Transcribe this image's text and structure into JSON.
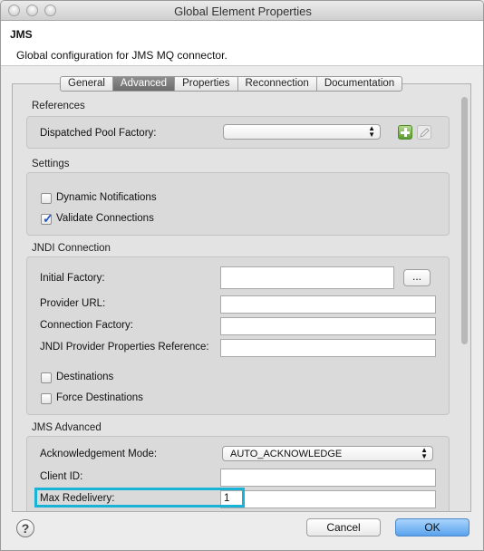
{
  "window": {
    "title": "Global Element Properties"
  },
  "header": {
    "title": "JMS",
    "description": "Global configuration for JMS MQ connector."
  },
  "tabs": [
    {
      "label": "General",
      "active": false
    },
    {
      "label": "Advanced",
      "active": true
    },
    {
      "label": "Properties",
      "active": false
    },
    {
      "label": "Reconnection",
      "active": false
    },
    {
      "label": "Documentation",
      "active": false
    }
  ],
  "references": {
    "section_label": "References",
    "dispatched_pool_factory_label": "Dispatched Pool Factory:",
    "dispatched_pool_factory_value": ""
  },
  "settings": {
    "section_label": "Settings",
    "dynamic_notifications_label": "Dynamic Notifications",
    "dynamic_notifications_checked": false,
    "validate_connections_label": "Validate Connections",
    "validate_connections_checked": true
  },
  "jndi": {
    "section_label": "JNDI Connection",
    "initial_factory_label": "Initial Factory:",
    "initial_factory_value": "",
    "browse_label": "...",
    "provider_url_label": "Provider URL:",
    "provider_url_value": "",
    "connection_factory_label": "Connection Factory:",
    "connection_factory_value": "",
    "provider_props_label": "JNDI Provider Properties Reference:",
    "provider_props_value": "",
    "destinations_label": "Destinations",
    "destinations_checked": false,
    "force_destinations_label": "Force Destinations",
    "force_destinations_checked": false
  },
  "jms_advanced": {
    "section_label": "JMS Advanced",
    "ack_mode_label": "Acknowledgement Mode:",
    "ack_mode_value": "AUTO_ACKNOWLEDGE",
    "client_id_label": "Client ID:",
    "client_id_value": "",
    "max_redelivery_label": "Max Redelivery:",
    "max_redelivery_value": "1"
  },
  "footer": {
    "help_label": "?",
    "cancel_label": "Cancel",
    "ok_label": "OK"
  },
  "colors": {
    "highlight": "#19b3d8",
    "ok_button": "#5aa2ee",
    "check": "#1e57c5"
  }
}
